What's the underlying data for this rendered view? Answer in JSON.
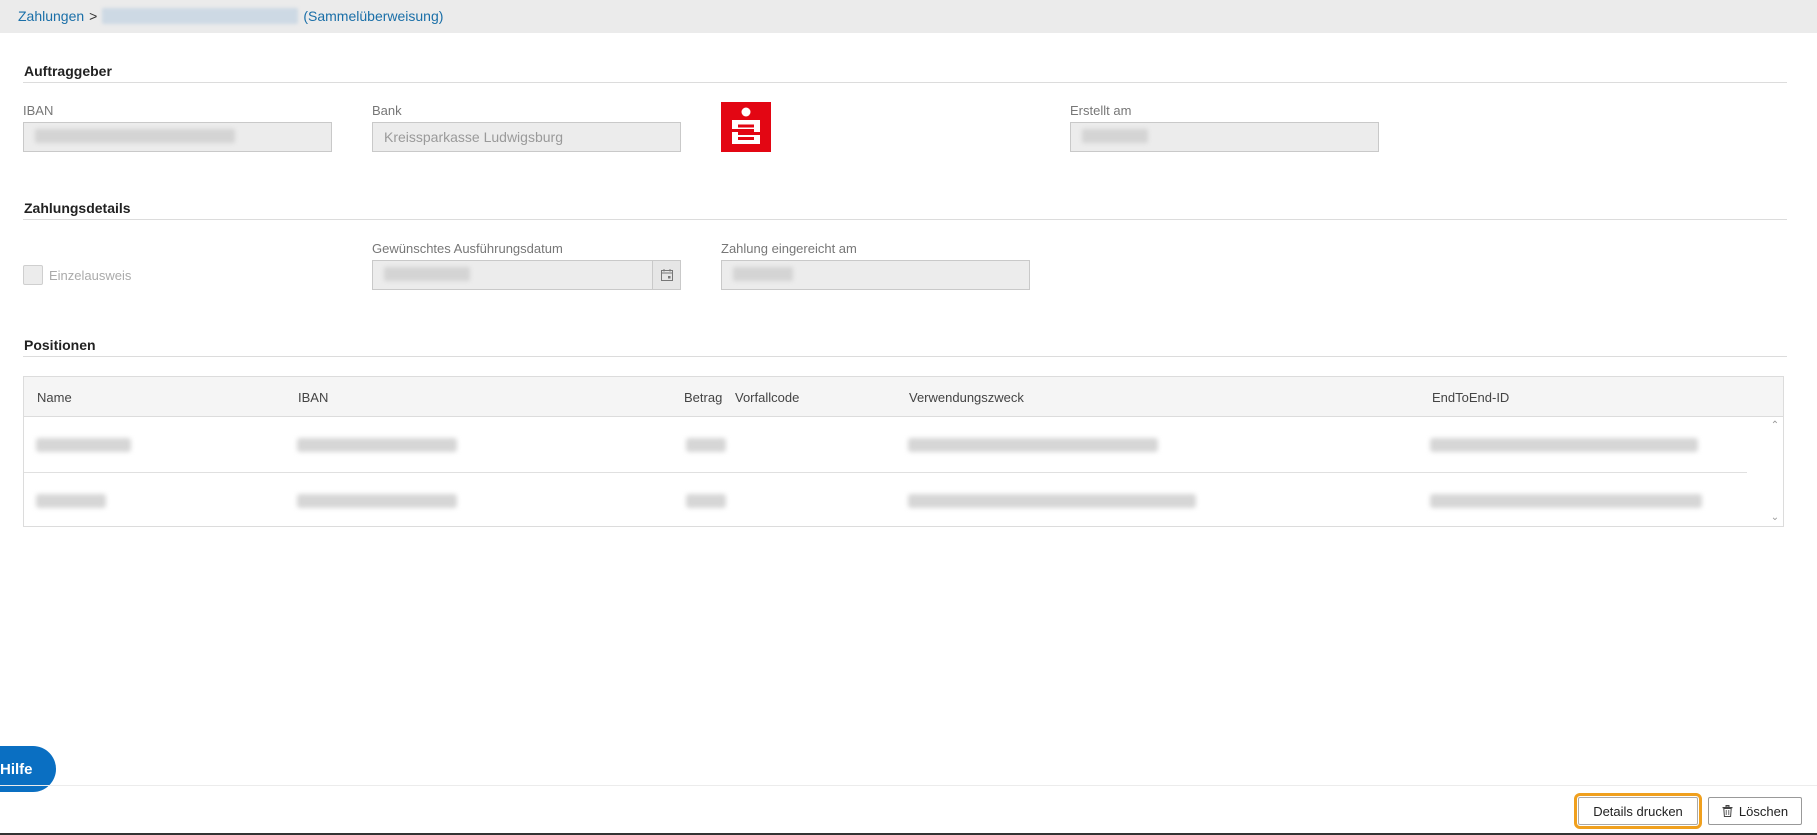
{
  "breadcrumb": {
    "root": "Zahlungen",
    "separator": ">",
    "type": "(Sammelüberweisung)"
  },
  "auftraggeber": {
    "title": "Auftraggeber",
    "iban_label": "IBAN",
    "bank_label": "Bank",
    "bank_value": "Kreissparkasse Ludwigsburg",
    "erstellt_label": "Erstellt am",
    "logo_icon": "sparkasse-logo-icon"
  },
  "zahlungsdetails": {
    "title": "Zahlungsdetails",
    "einzelausweis_label": "Einzelausweis",
    "ausfuehrung_label": "Gewünschtes Ausführungsdatum",
    "eingereicht_label": "Zahlung eingereicht am",
    "calendar_icon": "calendar-icon"
  },
  "positionen": {
    "title": "Positionen",
    "columns": [
      "Name",
      "IBAN",
      "Betrag",
      "Vorfallcode",
      "Verwendungszweck",
      "EndToEnd-ID"
    ]
  },
  "help": {
    "label": "Hilfe"
  },
  "actions": {
    "print_label": "Details drucken",
    "delete_label": "Löschen",
    "delete_icon": "trash-icon",
    "focus_color": "#f0a01e"
  },
  "colors": {
    "link": "#1a6fa8",
    "help_button": "#0a6fc2",
    "logo_red": "#e30613"
  }
}
